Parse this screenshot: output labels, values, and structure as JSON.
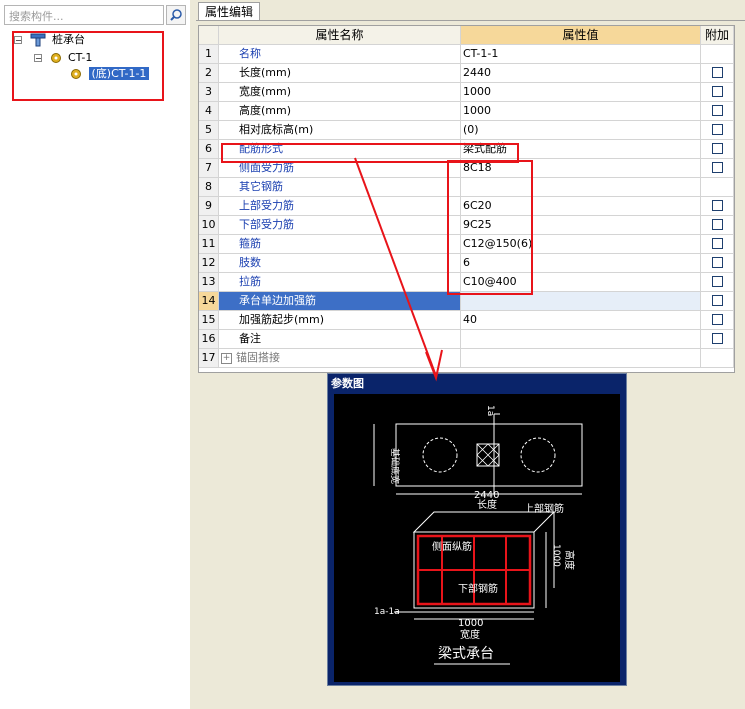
{
  "search": {
    "placeholder": "搜索构件..."
  },
  "tree": {
    "root": "桩承台",
    "child": "CT-1",
    "leaf": "(底)CT-1-1"
  },
  "tab": {
    "label": "属性编辑"
  },
  "grid": {
    "headers": [
      "属性名称",
      "属性值",
      "附加"
    ],
    "rows": [
      {
        "num": "1",
        "name": "名称",
        "value": "CT-1-1"
      },
      {
        "num": "2",
        "name": "长度(mm)",
        "value": "2440"
      },
      {
        "num": "3",
        "name": "宽度(mm)",
        "value": "1000"
      },
      {
        "num": "4",
        "name": "高度(mm)",
        "value": "1000"
      },
      {
        "num": "5",
        "name": "相对底标高(m)",
        "value": "(0)"
      },
      {
        "num": "6",
        "name": "配筋形式",
        "value": "梁式配筋"
      },
      {
        "num": "7",
        "name": "侧面受力筋",
        "value": "8C18"
      },
      {
        "num": "8",
        "name": "其它钢筋",
        "value": ""
      },
      {
        "num": "9",
        "name": "上部受力筋",
        "value": "6C20"
      },
      {
        "num": "10",
        "name": "下部受力筋",
        "value": "9C25"
      },
      {
        "num": "11",
        "name": "箍筋",
        "value": "C12@150(6)"
      },
      {
        "num": "12",
        "name": "肢数",
        "value": "6"
      },
      {
        "num": "13",
        "name": "拉筋",
        "value": "C10@400"
      },
      {
        "num": "14",
        "name": "承台单边加强筋",
        "value": ""
      },
      {
        "num": "15",
        "name": "加强筋起步(mm)",
        "value": "40"
      },
      {
        "num": "16",
        "name": "备注",
        "value": ""
      },
      {
        "num": "17",
        "name": "锚固搭接",
        "value": ""
      }
    ]
  },
  "diagram": {
    "title": "参数图",
    "label_1a": "1a",
    "label_base": "基础底宽",
    "label_2440": "2440",
    "label_length": "长度",
    "label_top_bar": "上部钢筋",
    "label_side_bar": "侧面纵筋",
    "label_1000_h": "1000",
    "label_height": "高度",
    "label_bottom_bar": "下部钢筋",
    "label_section": "1a-1a",
    "label_1000_w": "1000",
    "label_width": "宽度",
    "caption": "梁式承台"
  },
  "colors": {
    "highlight": "#e8141a",
    "selection": "#3169c6",
    "header_value_bg": "#f6d89a"
  }
}
